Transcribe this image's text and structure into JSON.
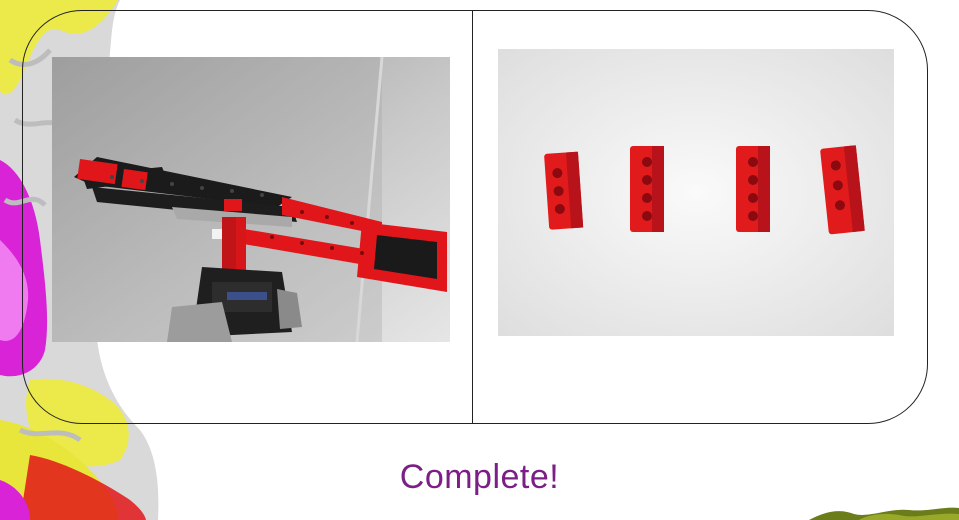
{
  "slide": {
    "caption": "Complete!",
    "caption_color": "#7b1f86"
  },
  "images": {
    "left_photo": "lego-crane-model",
    "right_photo": "four-red-technic-bricks"
  },
  "colors": {
    "brick_red": "#e0161a",
    "brick_black": "#1a1a1a",
    "decor_yellow": "#e8e63a",
    "decor_magenta": "#d21ad2"
  }
}
